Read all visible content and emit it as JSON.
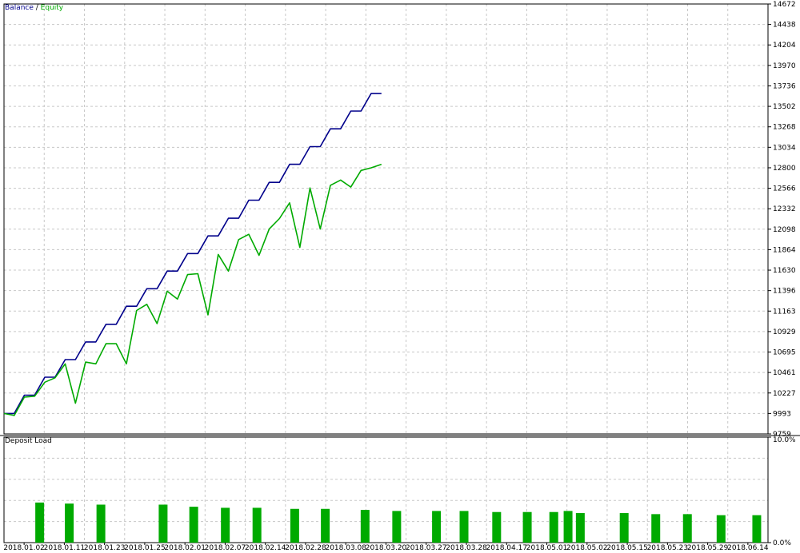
{
  "colors": {
    "background": "#ffffff",
    "grid": "#c8c8c8",
    "frame": "#000000",
    "balance": "#00008b",
    "equity": "#00aa00",
    "deposit_load": "#00aa00"
  },
  "chart_data": [
    {
      "type": "line",
      "legend": {
        "balance": "Balance",
        "separator": " / ",
        "equity": "Equity",
        "position": "top-left"
      },
      "grid": true,
      "y_axis_side": "right",
      "yticks": [
        "14672",
        "14438",
        "14204",
        "13970",
        "13736",
        "13502",
        "13268",
        "13034",
        "12800",
        "12566",
        "12332",
        "12098",
        "11864",
        "11630",
        "11396",
        "11163",
        "10929",
        "10695",
        "10461",
        "10227",
        "9993",
        "9759"
      ],
      "ylim": [
        9759,
        14672
      ],
      "x": [
        0,
        0.5,
        1,
        1.5,
        2,
        2.5,
        3,
        3.5,
        4,
        4.5,
        5,
        5.5,
        6,
        6.5,
        7,
        7.5,
        8,
        8.5,
        9,
        9.5,
        10,
        10.5,
        11,
        11.5,
        12,
        12.5,
        13,
        13.5,
        14,
        14.5,
        15,
        15.5,
        16,
        16.5,
        17,
        17.5,
        18,
        18.5
      ],
      "series": [
        {
          "name": "Balance",
          "color": "#00008b",
          "x": [
            0,
            0.5,
            1,
            1.5,
            2,
            2.5,
            3,
            3.5,
            4,
            4.5,
            5,
            5.5,
            6,
            6.5,
            7,
            7.5,
            8,
            8.5,
            9,
            9.5,
            10,
            10.5,
            11,
            11.5,
            12,
            12.5,
            13,
            13.5,
            14,
            14.5,
            15,
            15.5,
            16,
            16.5,
            17,
            17.5,
            18,
            18.5
          ],
          "values": [
            9993,
            9993,
            10202,
            10202,
            10407,
            10407,
            10608,
            10608,
            10810,
            10810,
            11012,
            11012,
            11218,
            11218,
            11418,
            11418,
            11620,
            11620,
            11820,
            11820,
            12022,
            12022,
            12224,
            12224,
            12430,
            12430,
            12634,
            12634,
            12840,
            12840,
            13042,
            13042,
            13246,
            13246,
            13448,
            13448,
            13650,
            13650
          ]
        },
        {
          "name": "Equity",
          "color": "#00aa00",
          "x": [
            0,
            0.5,
            1,
            1.5,
            2,
            2.5,
            3,
            3.5,
            4,
            4.5,
            5,
            5.5,
            6,
            6.5,
            7,
            7.5,
            8,
            8.5,
            9,
            9.5,
            10,
            10.5,
            11,
            11.5,
            12,
            12.5,
            13,
            13.5,
            14,
            14.5,
            15,
            15.5,
            16,
            16.5,
            17,
            17.5,
            18,
            18.5
          ],
          "values": [
            9993,
            9970,
            10180,
            10190,
            10350,
            10400,
            10560,
            10110,
            10580,
            10560,
            10790,
            10790,
            10560,
            11170,
            11240,
            11020,
            11390,
            11300,
            11580,
            11590,
            11120,
            11810,
            11620,
            11980,
            12040,
            11800,
            12100,
            12220,
            12400,
            11890,
            12570,
            12100,
            12600,
            12660,
            12580,
            12770,
            12800,
            12840
          ]
        }
      ]
    },
    {
      "type": "bar",
      "title": "Deposit Load",
      "grid": true,
      "y_axis_side": "right",
      "yticks": [
        "10.0%",
        "0.0%"
      ],
      "ylim": [
        0,
        10
      ],
      "unit": "%",
      "xticks": [
        "2018.01.02",
        "2018.01.11",
        "2018.01.23",
        "2018.01.25",
        "2018.02.01",
        "2018.02.07",
        "2018.02.14",
        "2018.02.28",
        "2018.03.08",
        "2018.03.20",
        "2018.03.27",
        "2018.03.28",
        "2018.04.17",
        "2018.05.01",
        "2018.05.02",
        "2018.05.15",
        "2018.05.23",
        "2018.05.29",
        "2018.06.14"
      ],
      "bars": [
        {
          "x": 1.75,
          "value": 3.8
        },
        {
          "x": 3.2,
          "value": 3.7
        },
        {
          "x": 4.75,
          "value": 3.6
        },
        {
          "x": 7.8,
          "value": 3.6
        },
        {
          "x": 9.3,
          "value": 3.4
        },
        {
          "x": 10.85,
          "value": 3.3
        },
        {
          "x": 12.4,
          "value": 3.3
        },
        {
          "x": 14.25,
          "value": 3.2
        },
        {
          "x": 15.75,
          "value": 3.2
        },
        {
          "x": 17.7,
          "value": 3.1
        },
        {
          "x": 19.25,
          "value": 3.0
        },
        {
          "x": 21.2,
          "value": 3.0
        },
        {
          "x": 22.55,
          "value": 3.0
        },
        {
          "x": 24.15,
          "value": 2.9
        },
        {
          "x": 25.65,
          "value": 2.9
        },
        {
          "x": 26.95,
          "value": 2.9
        },
        {
          "x": 27.65,
          "value": 3.0
        },
        {
          "x": 28.25,
          "value": 2.8
        },
        {
          "x": 30.4,
          "value": 2.8
        },
        {
          "x": 31.95,
          "value": 2.7
        },
        {
          "x": 33.5,
          "value": 2.7
        },
        {
          "x": 35.15,
          "value": 2.6
        },
        {
          "x": 36.9,
          "value": 2.6
        }
      ]
    }
  ]
}
